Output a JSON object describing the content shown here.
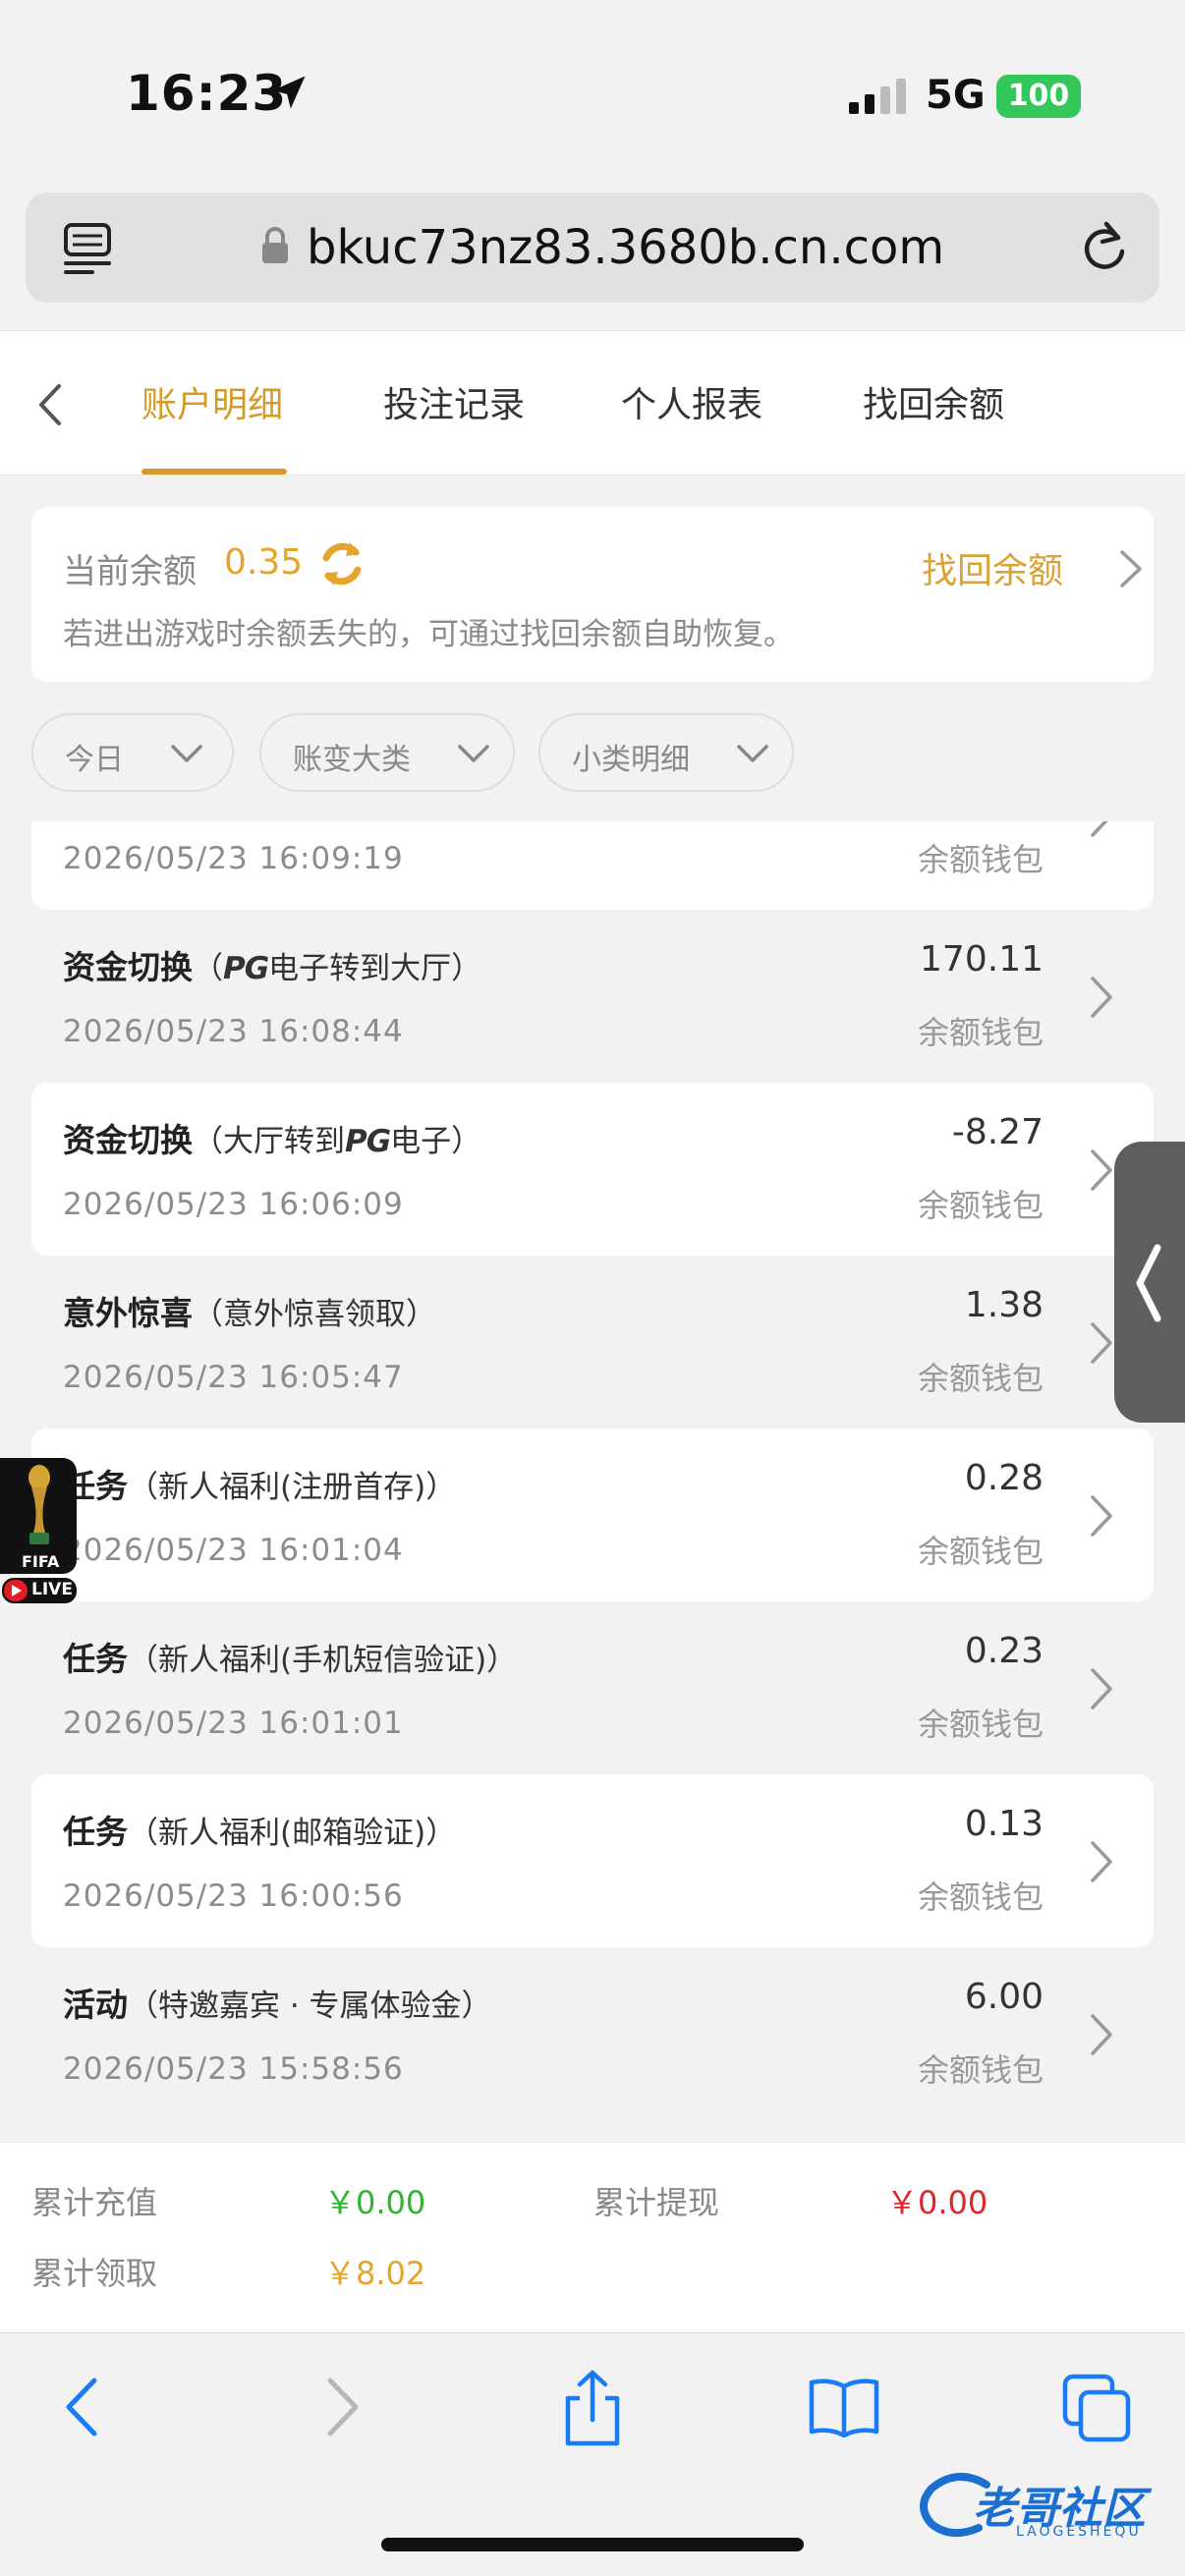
{
  "status_bar": {
    "time": "16:23",
    "network": "5G",
    "battery": "100",
    "icons": [
      "location-arrow-icon",
      "signal-icon",
      "battery-icon"
    ]
  },
  "browser": {
    "url": "bkuc73nz83.3680b.cn.com",
    "icons": [
      "reader-menu-icon",
      "lock-icon",
      "reload-icon"
    ]
  },
  "tabs": [
    {
      "label": "账户明细",
      "active": true
    },
    {
      "label": "投注记录",
      "active": false
    },
    {
      "label": "个人报表",
      "active": false
    },
    {
      "label": "找回余额",
      "active": false
    }
  ],
  "balance": {
    "label": "当前余额",
    "value": "0.35",
    "recover_link": "找回余额",
    "note": "若进出游戏时余额丢失的，可通过找回余额自助恢复。"
  },
  "filters": [
    {
      "label": "今日"
    },
    {
      "label": "账变大类"
    },
    {
      "label": "小类明细"
    }
  ],
  "records": [
    {
      "category": "",
      "detail": "",
      "time": "2026/05/23 16:09:19",
      "amount": "",
      "wallet": "余额钱包"
    },
    {
      "category": "资金切换",
      "detail_pre": "（",
      "pg": "PG",
      "detail": "电子转到大厅）",
      "time": "2026/05/23 16:08:44",
      "amount": "170.11",
      "wallet": "余额钱包"
    },
    {
      "category": "资金切换",
      "detail_pre": "（大厅转到",
      "pg": "PG",
      "detail": "电子）",
      "time": "2026/05/23 16:06:09",
      "amount": "-8.27",
      "wallet": "余额钱包"
    },
    {
      "category": "意外惊喜",
      "detail": "（意外惊喜领取）",
      "time": "2026/05/23 16:05:47",
      "amount": "1.38",
      "wallet": "余额钱包"
    },
    {
      "category": "任务",
      "detail": "（新人福利(注册首存)）",
      "time": "2026/05/23 16:01:04",
      "amount": "0.28",
      "wallet": "余额钱包"
    },
    {
      "category": "任务",
      "detail": "（新人福利(手机短信验证)）",
      "time": "2026/05/23 16:01:01",
      "amount": "0.23",
      "wallet": "余额钱包"
    },
    {
      "category": "任务",
      "detail": "（新人福利(邮箱验证)）",
      "time": "2026/05/23 16:00:56",
      "amount": "0.13",
      "wallet": "余额钱包"
    },
    {
      "category": "活动",
      "detail": "（特邀嘉宾 · 专属体验金）",
      "time": "2026/05/23 15:58:56",
      "amount": "6.00",
      "wallet": "余额钱包"
    }
  ],
  "summary": {
    "total_deposit_label": "累计充值",
    "total_deposit_value": "￥0.00",
    "total_withdraw_label": "累计提现",
    "total_withdraw_value": "￥0.00",
    "total_claim_label": "累计领取",
    "total_claim_value": "￥8.02",
    "colors": {
      "deposit": "#2fb52f",
      "withdraw": "#e0242b",
      "claim": "#e7a42b"
    }
  },
  "badge": {
    "fifa": "FIFA",
    "live": "LIVE"
  },
  "watermark": {
    "text": "老哥社区",
    "sub": "LAOGESHEQU"
  },
  "colors": {
    "accent": "#d49b27",
    "ios_blue": "#1a7cf5"
  }
}
